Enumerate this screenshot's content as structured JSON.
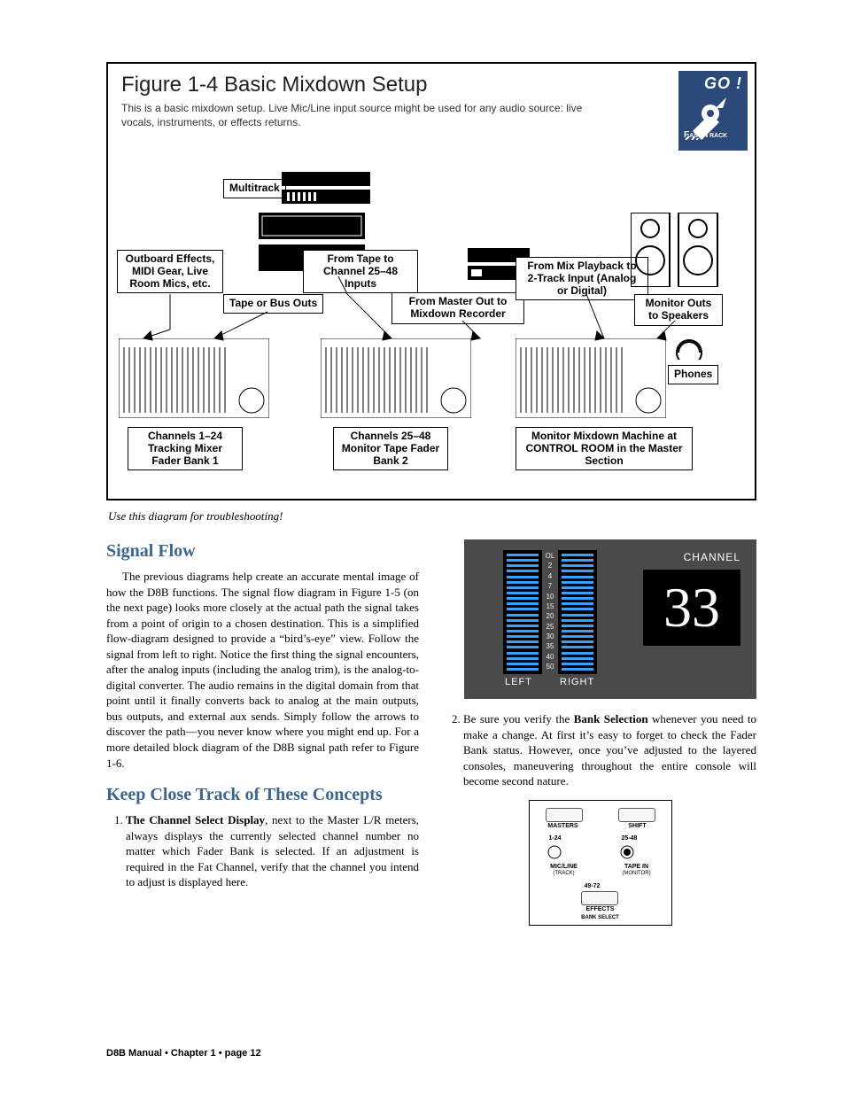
{
  "figure": {
    "title": "Figure 1-4 Basic Mixdown Setup",
    "intro": "This is a basic mixdown setup. Live Mic/Line input source might be used for any audio source: live vocals, instruments, or effects returns.",
    "go_label": "GO !",
    "fast_track": "Fast Track",
    "labels": {
      "multitrack": "Multitrack",
      "outboard": "Outboard Effects, MIDI Gear, Live Room Mics, etc.",
      "tape_bus": "Tape or Bus Outs",
      "from_tape": "From Tape to Channel 25–48 Inputs",
      "from_master": "From Master Out to Mixdown Recorder",
      "from_mix": "From Mix Playback to 2-Track Input (Analog or Digital)",
      "monitor_outs": "Monitor Outs to Speakers",
      "phones": "Phones",
      "ch1": "Channels 1–24 Tracking Mixer Fader Bank 1",
      "ch25": "Channels 25–48 Monitor Tape Fader Bank 2",
      "monmix": "Monitor Mixdown Machine at CONTROL ROOM in the Master Section"
    }
  },
  "caption": "Use this diagram for troubleshooting!",
  "sections": {
    "signal_flow": {
      "heading": "Signal Flow",
      "body": "The previous diagrams help create an accurate mental image of how the D8B functions. The signal flow diagram in Figure 1-5 (on the next page) looks more closely at the actual path the signal takes from a point of origin to a chosen destination. This is a simplified flow-diagram designed to provide a “bird’s-eye” view. Follow the signal from left to right. Notice the first thing the signal encounters, after the analog inputs (including the analog trim), is the analog-to-digital converter. The audio remains in the digital domain from that point until it finally converts back to analog at the main outputs, bus outputs, and external aux sends. Simply follow the arrows to discover the path—you never know where you might end up. For a more detailed block diagram of the D8B signal path refer to Figure 1-6."
    },
    "keep_close": {
      "heading": "Keep Close Track of These Concepts",
      "item1_bold": "The Channel Select Display",
      "item1_rest": ", next to the Master L/R meters, always displays the currently selected channel number no matter which Fader Bank is selected. If an adjustment is required in the Fat Channel, verify that the channel you intend to adjust is displayed here.",
      "item2_pre": "Be sure you verify the ",
      "item2_bold": "Bank Selection",
      "item2_rest": " whenever you need to make a change. At first it’s easy to forget to check the Fader Bank status. However, once you’ve adjusted to the layered consoles, maneuvering throughout the entire console will become second nature."
    }
  },
  "meter": {
    "channel_word": "CHANNEL",
    "channel_value": "33",
    "left": "LEFT",
    "right": "RIGHT",
    "scale": [
      "OL",
      "2",
      "4",
      "7",
      "10",
      "15",
      "20",
      "25",
      "30",
      "35",
      "40",
      "50"
    ]
  },
  "bank": {
    "masters": "MASTERS",
    "shift": "SHIFT",
    "b1": "1-24",
    "b2": "25-48",
    "mic": "MIC/LINE",
    "mic2": "(TRACK)",
    "tape": "TAPE IN",
    "tape2": "(MONITOR)",
    "b3": "49-72",
    "effects": "EFFECTS",
    "bank_select": "BANK SELECT"
  },
  "footer": "D8B Manual • Chapter 1 • page  12"
}
